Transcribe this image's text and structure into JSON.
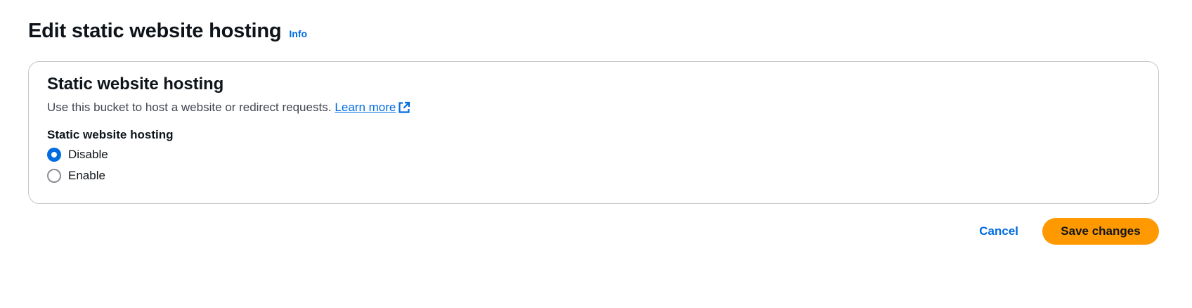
{
  "header": {
    "title": "Edit static website hosting",
    "info_label": "Info"
  },
  "section": {
    "title": "Static website hosting",
    "description": "Use this bucket to host a website or redirect requests.",
    "learn_more_label": "Learn more",
    "learn_more_icon": "external-link-icon",
    "field_label": "Static website hosting",
    "options": [
      {
        "label": "Disable",
        "selected": true
      },
      {
        "label": "Enable",
        "selected": false
      }
    ]
  },
  "actions": {
    "cancel_label": "Cancel",
    "save_label": "Save changes"
  },
  "colors": {
    "link": "#006ce0",
    "primary_button": "#ff9900",
    "border": "#c6c6cd",
    "text": "#0f141a"
  }
}
